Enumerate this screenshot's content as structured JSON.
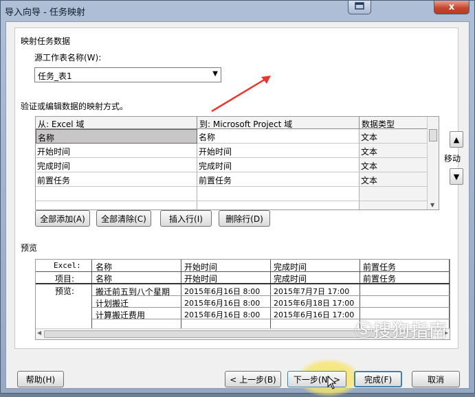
{
  "window": {
    "title": "导入向导 - 任务映射",
    "restore_icon": "restore-icon",
    "close_icon": "close-icon",
    "close_glyph": "x"
  },
  "mapping": {
    "section_title": "映射任务数据",
    "source_label": "源工作表名称(W):",
    "source_value": "任务_表1",
    "verify_label": "验证或编辑数据的映射方式。",
    "columns": [
      "从: Excel 域",
      "到: Microsoft Project 域",
      "数据类型"
    ],
    "rows": [
      {
        "from": "名称",
        "to": "名称",
        "type": "文本"
      },
      {
        "from": "开始时间",
        "to": "开始时间",
        "type": "文本"
      },
      {
        "from": "完成时间",
        "to": "完成时间",
        "type": "文本"
      },
      {
        "from": "前置任务",
        "to": "前置任务",
        "type": "文本"
      }
    ],
    "move_label": "移动",
    "buttons": {
      "add_all": "全部添加(A)",
      "clear_all": "全部清除(C)",
      "insert_row": "插入行(I)",
      "delete_row": "删除行(D)"
    }
  },
  "preview": {
    "section_title": "预览",
    "excel_label": "Excel:",
    "project_label": "项目:",
    "preview_label": "预览:",
    "excel_headers": [
      "名称",
      "开始时间",
      "完成时间",
      "前置任务"
    ],
    "project_headers": [
      "名称",
      "开始时间",
      "完成时间",
      "前置任务"
    ],
    "rows": [
      [
        "搬迁前五到八个星期",
        "2015年6月16日  8:00",
        "2015年7月7日  17:00",
        ""
      ],
      [
        "计划搬迁",
        "2015年6月16日  8:00",
        "2015年6月18日  17:00",
        ""
      ],
      [
        "计算搬迁费用",
        "2015年6月16日  8:00",
        "2015年6月16日  17:00",
        ""
      ]
    ]
  },
  "footer": {
    "help": "帮助(H)",
    "back": "< 上一步(B)",
    "next": "下一步(N) >",
    "finish": "完成(F)",
    "cancel": "取消"
  },
  "watermark": {
    "text": "搜狗指南"
  },
  "colors": {
    "arrow": "#e8372c",
    "selection": "#c8c6c6",
    "highlight": "#f7e56a"
  }
}
